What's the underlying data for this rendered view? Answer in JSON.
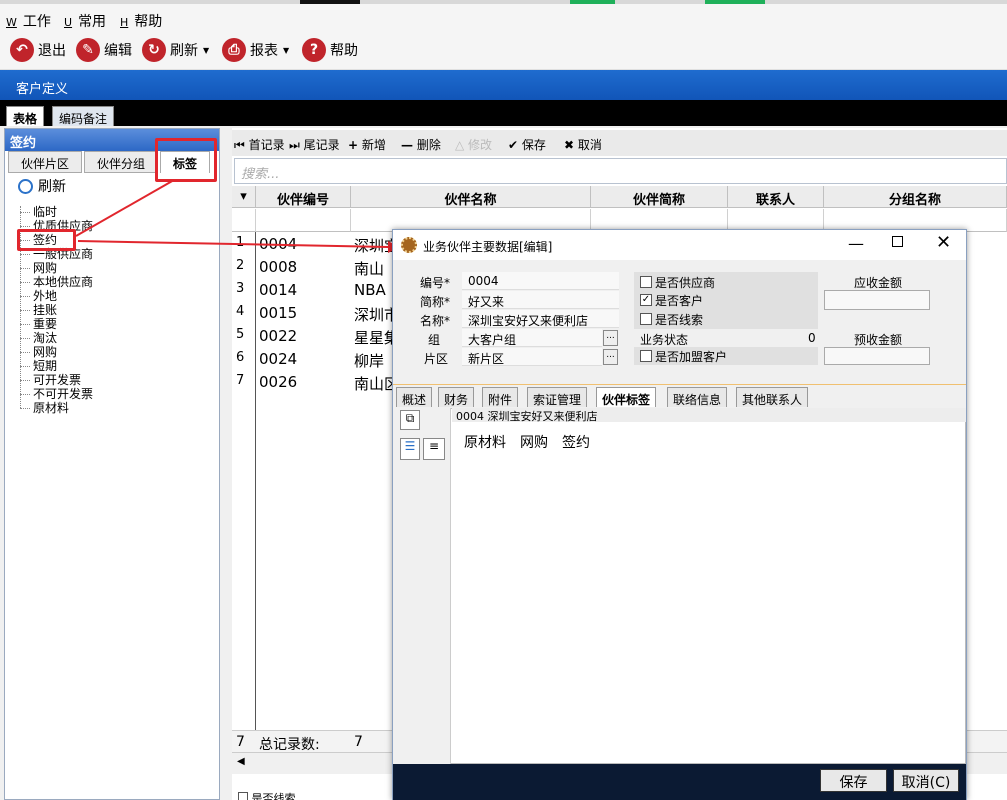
{
  "menu": {
    "items": [
      {
        "key": "W",
        "label": "工作"
      },
      {
        "key": "U",
        "label": "常用"
      },
      {
        "key": "H",
        "label": "帮助"
      }
    ]
  },
  "toolbar": {
    "exit": "退出",
    "edit": "编辑",
    "refresh": "刷新",
    "report": "报表",
    "help": "帮助"
  },
  "window_title": "客户定义",
  "main_tabs": [
    "表格",
    "编码备注"
  ],
  "left_panel": {
    "header": "签约",
    "tabs": [
      "伙伴片区",
      "伙伴分组",
      "标签"
    ],
    "refresh_label": "刷新",
    "tree_items": [
      "临时",
      "优质供应商",
      "签约",
      "一般供应商",
      "网购",
      "本地供应商",
      "外地",
      "挂账",
      "重要",
      "淘汰",
      "网购",
      "短期",
      "可开发票",
      "不可开发票",
      "原材料"
    ]
  },
  "grid": {
    "toolbar": {
      "first": "首记录",
      "last": "尾记录",
      "add": "新增",
      "delete": "删除",
      "modify": "修改",
      "save": "保存",
      "cancel": "取消"
    },
    "search_placeholder": "搜索...",
    "columns": [
      "伙伴编号",
      "伙伴名称",
      "伙伴简称",
      "联系人",
      "分组名称"
    ],
    "rows": [
      {
        "num": "1",
        "code": "0004",
        "name": "深圳宝"
      },
      {
        "num": "2",
        "code": "0008",
        "name": "南山"
      },
      {
        "num": "3",
        "code": "0014",
        "name": "NBA"
      },
      {
        "num": "4",
        "code": "0015",
        "name": "深圳市"
      },
      {
        "num": "5",
        "code": "0022",
        "name": "星星集"
      },
      {
        "num": "6",
        "code": "0024",
        "name": "柳岸"
      },
      {
        "num": "7",
        "code": "0026",
        "name": "南山区"
      }
    ],
    "footer": {
      "count": "7",
      "label": "总记录数:",
      "value": "7"
    },
    "bottom_checkbox": "是否线索"
  },
  "dialog": {
    "title": "业务伙伴主要数据[编辑]",
    "fields": [
      {
        "label": "编号*",
        "value": "0004"
      },
      {
        "label": "简称*",
        "value": "好又来"
      },
      {
        "label": "名称*",
        "value": "深圳宝安好又来便利店"
      },
      {
        "label": "组",
        "value": "大客户组"
      },
      {
        "label": "片区",
        "value": "新片区"
      }
    ],
    "checkboxes": [
      {
        "label": "是否供应商",
        "checked": false
      },
      {
        "label": "是否客户",
        "checked": true
      },
      {
        "label": "是否线索",
        "checked": false
      }
    ],
    "business_status_label": "业务状态",
    "business_status_value": "0",
    "franchise_label": "是否加盟客户",
    "receivable_label": "应收金额",
    "prepaid_label": "预收金额",
    "tabs": [
      "概述",
      "财务",
      "附件",
      "索证管理",
      "伙伴标签",
      "联络信息",
      "其他联系人"
    ],
    "tag_header": "0004  深圳宝安好又来便利店",
    "tags": [
      "原材料",
      "网购",
      "签约"
    ],
    "save_label": "保存",
    "cancel_label": "取消(C)"
  },
  "colors": {
    "title_blue": "#1f6ccf",
    "annotation_red": "#e1262d",
    "icon_red": "#c0242b"
  }
}
